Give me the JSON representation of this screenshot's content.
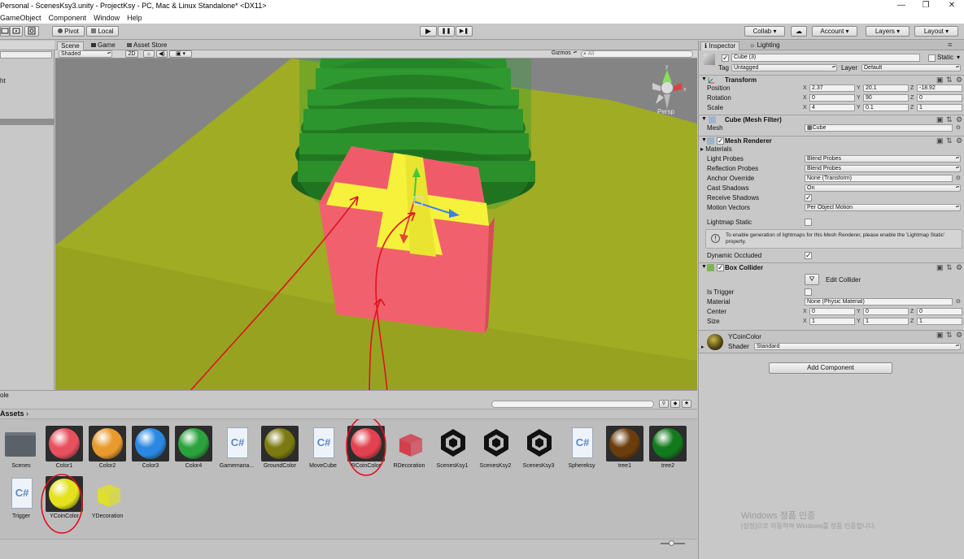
{
  "window": {
    "title": "Personal - ScenesKsy3.unity - ProjectKsy - PC, Mac & Linux Standalone* <DX11>",
    "controls": [
      "—",
      "❐",
      "✕"
    ]
  },
  "menu": [
    "GameObject",
    "Component",
    "Window",
    "Help"
  ],
  "toolbar": {
    "pivot": "Pivot",
    "local": "Local",
    "play_icons": [
      "▶",
      "❚❚",
      "▶❚"
    ],
    "collab": "Collab",
    "cloud_icon": "☁",
    "account": "Account",
    "layers": "Layers",
    "layout": "Layout"
  },
  "hierarchy": {
    "row_text": "ht"
  },
  "scene_tabs": {
    "scene": "Scene",
    "game": "Game",
    "asset_store": "Asset Store"
  },
  "scene_toolbar": {
    "shading": "Shaded",
    "mode_2d": "2D",
    "gizmos": "Gizmos",
    "search": "All"
  },
  "scene_view": {
    "persp": "Persp",
    "axes": {
      "y": "y",
      "x": "x"
    }
  },
  "project": {
    "tab": "ole",
    "breadcrumb": "Assets",
    "assets": [
      {
        "name": "Scenes",
        "kind": "folder"
      },
      {
        "name": "Color1",
        "kind": "material",
        "color": "#e8505e"
      },
      {
        "name": "Color2",
        "kind": "material",
        "color": "#e99a2c"
      },
      {
        "name": "Color3",
        "kind": "material",
        "color": "#2a88e0"
      },
      {
        "name": "Color4",
        "kind": "material",
        "color": "#2aa33c"
      },
      {
        "name": "Gamemana...",
        "kind": "script"
      },
      {
        "name": "GroundColor",
        "kind": "material",
        "color": "#7b7a10"
      },
      {
        "name": "MoveCube",
        "kind": "script"
      },
      {
        "name": "RCoinColor",
        "kind": "material",
        "color": "#e2424f"
      },
      {
        "name": "RDecoration",
        "kind": "prefab",
        "color": "#d2404e"
      },
      {
        "name": "ScenesKsy1",
        "kind": "scene"
      },
      {
        "name": "ScenesKsy2",
        "kind": "scene"
      },
      {
        "name": "ScenesKsy3",
        "kind": "scene"
      },
      {
        "name": "Sphereksy",
        "kind": "script"
      },
      {
        "name": "tree1",
        "kind": "material",
        "color": "#6b3d0c"
      },
      {
        "name": "tree2",
        "kind": "material",
        "color": "#127a1c"
      },
      {
        "name": "Trigger",
        "kind": "script"
      },
      {
        "name": "YCoinColor",
        "kind": "material",
        "color": "#e3e21c"
      },
      {
        "name": "YDecoration",
        "kind": "prefab",
        "color": "#e0df2a"
      }
    ],
    "script_glyph": "C#"
  },
  "inspector": {
    "tabs": {
      "inspector": "Inspector",
      "lighting": "Lighting"
    },
    "object_name": "Cube (3)",
    "static_label": "Static",
    "tag_label": "Tag",
    "tag_value": "Untagged",
    "layer_label": "Layer",
    "layer_value": "Default",
    "transform": {
      "title": "Transform",
      "position_label": "Position",
      "rotation_label": "Rotation",
      "scale_label": "Scale",
      "position": [
        "2.37",
        "20.1",
        "-18.92"
      ],
      "rotation": [
        "0",
        "90",
        "0"
      ],
      "scale": [
        "4",
        "0.1",
        "1"
      ],
      "axes": [
        "X",
        "Y",
        "Z"
      ]
    },
    "mesh_filter": {
      "title": "Cube (Mesh Filter)",
      "mesh_label": "Mesh",
      "mesh_value": "Cube"
    },
    "mesh_renderer": {
      "title": "Mesh Renderer",
      "materials_label": "Materials",
      "light_probes_label": "Light Probes",
      "light_probes_value": "Blend Probes",
      "reflection_probes_label": "Reflection Probes",
      "reflection_probes_value": "Blend Probes",
      "anchor_override_label": "Anchor Override",
      "anchor_override_value": "None (Transform)",
      "cast_shadows_label": "Cast Shadows",
      "cast_shadows_value": "On",
      "receive_shadows_label": "Receive Shadows",
      "motion_vectors_label": "Motion Vectors",
      "motion_vectors_value": "Per Object Motion",
      "lightmap_static_label": "Lightmap Static",
      "lightmap_note": "To enable generation of lightmaps for this Mesh Renderer, please enable the 'Lightmap Static' property.",
      "dynamic_occluded_label": "Dynamic Occluded"
    },
    "box_collider": {
      "title": "Box Collider",
      "edit_collider": "Edit Collider",
      "is_trigger_label": "Is Trigger",
      "material_label": "Material",
      "material_value": "None (Physic Material)",
      "center_label": "Center",
      "size_label": "Size",
      "center": [
        "0",
        "0",
        "0"
      ],
      "size": [
        "1",
        "1",
        "1"
      ]
    },
    "material": {
      "name": "YCoinColor",
      "shader_label": "Shader",
      "shader_value": "Standard"
    },
    "add_component": "Add Component",
    "watermark_line1": "Windows 정품 인증",
    "watermark_line2": "[설정]으로 이동하여 Windows를 정품 인증합니다."
  }
}
